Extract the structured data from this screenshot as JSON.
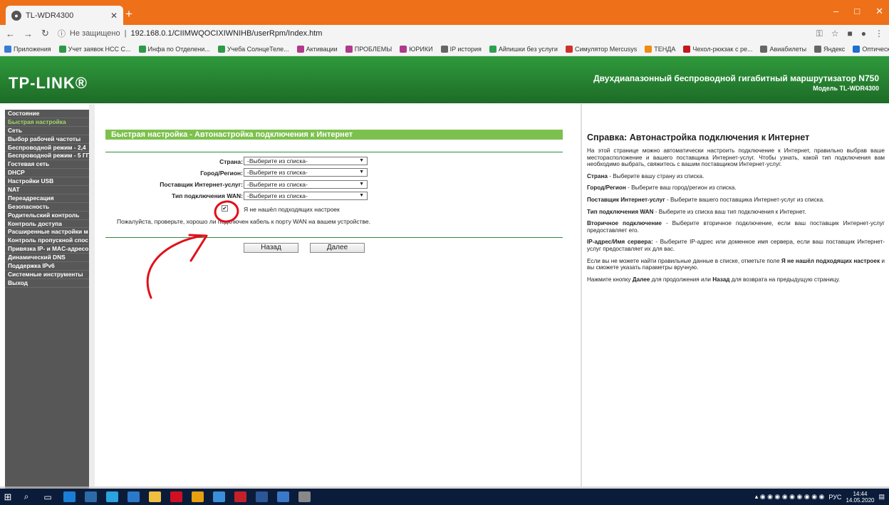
{
  "browser": {
    "tab_title": "TL-WDR4300",
    "new_tab": "+",
    "security": "Не защищено",
    "url": "192.168.0.1/CIIMWQOCIXIWNIHB/userRpm/Index.htm",
    "window_controls": [
      "–",
      "□",
      "✕"
    ]
  },
  "bookmarks": [
    {
      "label": "Приложения",
      "color": "#3a7bd5"
    },
    {
      "label": "Учет заявок НСС С...",
      "color": "#2e9a48"
    },
    {
      "label": "Инфа по Отделени...",
      "color": "#2e9a48"
    },
    {
      "label": "Учеба СолнцеТеле...",
      "color": "#2e9a48"
    },
    {
      "label": "Активации",
      "color": "#b03a8c"
    },
    {
      "label": "ПРОБЛЕМЫ",
      "color": "#b03a8c"
    },
    {
      "label": "ЮРИКИ",
      "color": "#b03a8c"
    },
    {
      "label": "IP история",
      "color": "#666666"
    },
    {
      "label": "Айпишки без услуги",
      "color": "#2ea050"
    },
    {
      "label": "Симулятор Mercusys",
      "color": "#d0302c"
    },
    {
      "label": "ТЕНДА",
      "color": "#f08a12"
    },
    {
      "label": "Чехол-рюкзак с ре...",
      "color": "#c4161c"
    },
    {
      "label": "Авиабилеты",
      "color": "#666666"
    },
    {
      "label": "Яндекс",
      "color": "#666666"
    },
    {
      "label": "Оптические волок...",
      "color": "#1e6fd0"
    },
    {
      "label": "»",
      "color": ""
    }
  ],
  "header": {
    "logo": "TP-LINK®",
    "title": "Двухдиапазонный беспроводной гигабитный маршрутизатор N750",
    "model": "Модель TL-WDR4300"
  },
  "sidebar": {
    "items": [
      {
        "label": "Состояние",
        "active": false
      },
      {
        "label": "Быстрая настройка",
        "active": true
      },
      {
        "label": "Сеть",
        "active": false
      },
      {
        "label": "Выбор рабочей частоты",
        "active": false
      },
      {
        "label": "Беспроводной режим - 2,4",
        "active": false
      },
      {
        "label": "Беспроводной режим - 5 ГГ",
        "active": false
      },
      {
        "label": "Гостевая сеть",
        "active": false
      },
      {
        "label": "DHCP",
        "active": false
      },
      {
        "label": "Настройки USB",
        "active": false
      },
      {
        "label": "NAT",
        "active": false
      },
      {
        "label": "Переадресация",
        "active": false
      },
      {
        "label": "Безопасность",
        "active": false
      },
      {
        "label": "Родительский контроль",
        "active": false
      },
      {
        "label": "Контроль доступа",
        "active": false
      },
      {
        "label": "Расширенные настройки м",
        "active": false
      },
      {
        "label": "Контроль пропускной спос",
        "active": false
      },
      {
        "label": "Привязка IP- и MAC-адресо",
        "active": false
      },
      {
        "label": "Динамический DNS",
        "active": false
      },
      {
        "label": "Поддержка IPv6",
        "active": false
      },
      {
        "label": "Системные инструменты",
        "active": false
      },
      {
        "label": "Выход",
        "active": false
      }
    ]
  },
  "main": {
    "title": "Быстрая настройка - Автонастройка подключения к Интернет",
    "fields": [
      {
        "label": "Страна:",
        "value": "-Выберите из списка-"
      },
      {
        "label": "Город/Регион:",
        "value": "-Выберите из списка-"
      },
      {
        "label": "Поставщик Интернет-услуг:",
        "value": "-Выберите из списка-"
      },
      {
        "label": "Тип подключения WAN:",
        "value": "-Выберите из списка-"
      }
    ],
    "checkbox_label": "Я не нашёл подходящих настроек",
    "checkbox_checked": true,
    "checkbox_mark": "✔",
    "select_arrow": "▼",
    "note": "Пожалуйста, проверьте, хорошо ли подключен кабель к порту WAN на вашем устройстве.",
    "back_button": "Назад",
    "next_button": "Далее"
  },
  "help": {
    "title": "Справка: Автонастройка подключения к Интернет",
    "intro": "На этой странице можно автоматически настроить подключение к Интернет, правильно выбрав ваше месторасположение и вашего поставщика Интернет-услуг. Чтобы узнать, какой тип подключения вам необходимо выбрать, свяжитесь с вашим поставщиком Интернет-услуг.",
    "items": [
      {
        "term": "Страна",
        "text": " - Выберите вашу страну из списка."
      },
      {
        "term": "Город/Регион",
        "text": " - Выберите ваш город/регион из списка."
      },
      {
        "term": "Поставщик Интернет-услуг",
        "text": " - Выберите вашего поставщика Интернет-услуг из списка."
      },
      {
        "term": "Тип подключения WAN",
        "text": " - Выберите из списка ваш тип подключения к Интернет."
      },
      {
        "term": "Вторичное подключение",
        "text": " - Выберите вторичное подключение, если ваш поставщик Интернет-услуг предоставляет его."
      },
      {
        "term": "IP-адрес/Имя сервера:",
        "text": " - Выберите IP-адрес или доменное имя сервера, если ваш поставщик Интернет-услуг предоставляет их для вас."
      }
    ],
    "manual_pre": "Если вы не можете найти правильные данные в списке, отметьте поле ",
    "manual_bold": "Я не нашёл подходящих настроек",
    "manual_post": " и вы сможете указать параметры вручную.",
    "nav_pre": "Нажмите кнопку ",
    "nav_next": "Далее",
    "nav_mid": " для продолжения или ",
    "nav_back": "Назад",
    "nav_post": " для возврата на предыдущую страницу."
  },
  "annotation": {
    "color": "#e0101a"
  },
  "taskbar": {
    "apps": [
      {
        "icon": "edge-icon",
        "color": "#1a7fd4"
      },
      {
        "icon": "app-icon",
        "color": "#2d6ba8"
      },
      {
        "icon": "telegram-icon",
        "color": "#2aa3df"
      },
      {
        "icon": "mail-icon",
        "color": "#2b78c9"
      },
      {
        "icon": "explorer-icon",
        "color": "#f0c040"
      },
      {
        "icon": "opera-icon",
        "color": "#d01020"
      },
      {
        "icon": "chrome-icon",
        "color": "#e8a010"
      },
      {
        "icon": "app-icon",
        "color": "#3a8fd8"
      },
      {
        "icon": "app-icon",
        "color": "#c4202a"
      },
      {
        "icon": "word-icon",
        "color": "#2b5797"
      },
      {
        "icon": "app-icon",
        "color": "#3a78c8"
      },
      {
        "icon": "app-icon",
        "color": "#888888"
      }
    ],
    "lang": "РУС",
    "time": "14:44",
    "date": "14.05.2020"
  }
}
